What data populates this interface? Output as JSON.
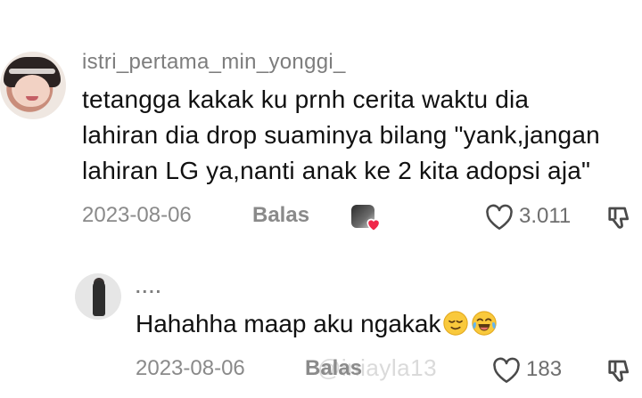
{
  "comments": [
    {
      "username": "istri_pertama_min_yonggi_",
      "text_lines": [
        "tetangga kakak ku prnh cerita waktu dia",
        "lahiran dia drop suaminya bilang \"yank,jangan",
        "lahiran LG ya,nanti anak ke 2 kita adopsi aja\""
      ],
      "date": "2023-08-06",
      "reply_label": "Balas",
      "like_count": "3.011",
      "liked_by_creator": true
    },
    {
      "username": "....",
      "text": "Hahahha maap aku ngakak",
      "emojis": [
        "relieved-face-emoji",
        "tears-of-joy-emoji"
      ],
      "date": "2023-08-06",
      "reply_label": "Balas",
      "like_count": "183"
    }
  ],
  "watermark": "@iniayla13",
  "colors": {
    "text_primary": "#111111",
    "text_secondary": "#8a8a8a",
    "heart_accent": "#f0284a"
  }
}
